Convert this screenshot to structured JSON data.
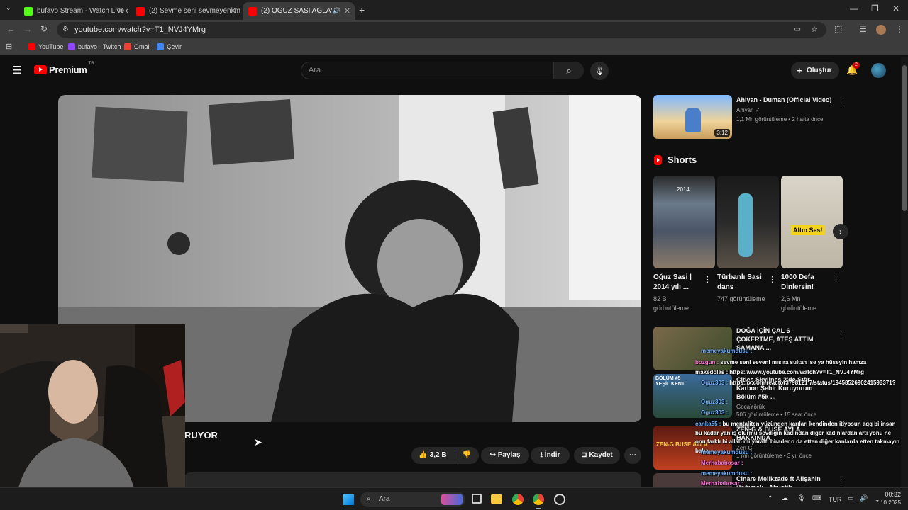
{
  "browser": {
    "tabs": [
      {
        "title": "bufavo Stream - Watch Live on",
        "favicon_color": "#53fc18"
      },
      {
        "title": "(2) Sevme seni sevmeyeni mısır",
        "favicon_color": "#ff0000"
      },
      {
        "title": "(2) OĞUZ SASİ AĞLAYARAK",
        "favicon_color": "#ff0000"
      }
    ],
    "url": "youtube.com/watch?v=T1_NVJ4YMrg",
    "bookmarks": [
      {
        "label": "YouTube",
        "color": "#ff0000"
      },
      {
        "label": "bufavo - Twitch",
        "color": "#9146ff"
      },
      {
        "label": "Gmail",
        "color": "#ea4335"
      },
      {
        "label": "Çevir",
        "color": "#4285f4"
      }
    ]
  },
  "youtube": {
    "logo": "Premium",
    "region": "TR",
    "search_placeholder": "Ara",
    "create_label": "Oluştur",
    "notification_count": "2"
  },
  "video": {
    "title_fragment": "RUYOR",
    "like_count": "3,2 B",
    "share_label": "Paylaş",
    "download_label": "İndir",
    "save_label": "Kaydet"
  },
  "sidebar": {
    "top_video": {
      "title": "Ahiyan - Duman (Official Video)",
      "channel": "Ahiyan",
      "meta": "1,1 Mn görüntüleme • 2 hafta önce",
      "duration": "3:12"
    },
    "shorts_heading": "Shorts",
    "shorts": [
      {
        "title": "Oğuz Sasi | 2014 yılı ...",
        "views": "82 B görüntüleme",
        "overlay": "2014"
      },
      {
        "title": "Türbanlı Sasi dans",
        "views": "747 görüntüleme",
        "overlay": ""
      },
      {
        "title": "1000 Defa Dinlersin!",
        "views": "2,6 Mn görüntüleme",
        "overlay": "Altın Ses!"
      }
    ],
    "videos": [
      {
        "title": "DOĞA İÇİN ÇAL 6 - ÇÖKERTME, ATEŞ ATTIM SAMANA ...",
        "meta1": "Doğa İçin Çal",
        "meta2": "29 Mn görüntüleme • 10 yıl önce"
      },
      {
        "title": "Cities Skylines 2'de Sıfır Karbon Şehir Kuruyorum Bölüm #5k ...",
        "meta1": "GocaYörük",
        "meta2": "506 görüntüleme • 15 saat önce",
        "badge": "Yeni",
        "thumb_text": "BÖLÜM #5 YEŞİL KENT"
      },
      {
        "title": "ZEN-G & BUSE AYLA HAKKINDA",
        "meta1": "Zen-G",
        "meta2": "1 Mn görüntüleme • 3 yıl önce",
        "thumb_text": "ZEN-G BUSE AYLA"
      },
      {
        "title": "Cinare Melikzade ft Alişahin Bağırsak - Akustik",
        "meta1": "",
        "meta2": ""
      }
    ]
  },
  "chat": [
    {
      "user": "memeyakumdusu :",
      "text": ""
    },
    {
      "user": "bozgun :",
      "text": "sevme seni seveni mısıra sultan ise ya hüseyin hamza"
    },
    {
      "user": "makedolas :",
      "text": "https://www.youtube.com/watch?v=T1_NVJ4YMrg"
    },
    {
      "user": "Oguz303 :",
      "text": "https://x.com/reactor3798121 7/status/1945852690241593371?"
    },
    {
      "user": "Oguz303 :",
      "text": ""
    },
    {
      "user": "Oguz303 :",
      "text": ""
    },
    {
      "user": "canka55 :",
      "text": "bu mentaliten yüzünden karıları kendinden itiyosun aqq bi insan bu kadar yanlış olurmu sevdiğin kadından diğer kadınlardan artı yönü ne onu farklı bi"
    },
    {
      "user": "",
      "text": "allah mı yarattı birader o da etten diğer kanlarda etten takmayın baba"
    },
    {
      "user": "memeyakumdusu :",
      "text": ""
    },
    {
      "user": "Merhababosar :",
      "text": ""
    },
    {
      "user": "memeyakumdusu :",
      "text": ""
    },
    {
      "user": "Merhababosar :",
      "text": ""
    }
  ],
  "taskbar": {
    "search_label": "Ara",
    "lang": "TUR",
    "time": "00:32",
    "date": "7.10.2025"
  },
  "colors": {
    "yt_red": "#ff0000",
    "bg": "#0f0f0f",
    "chat_user": "#6fb3ff",
    "chat_user_alt": "#ff6fd8"
  }
}
